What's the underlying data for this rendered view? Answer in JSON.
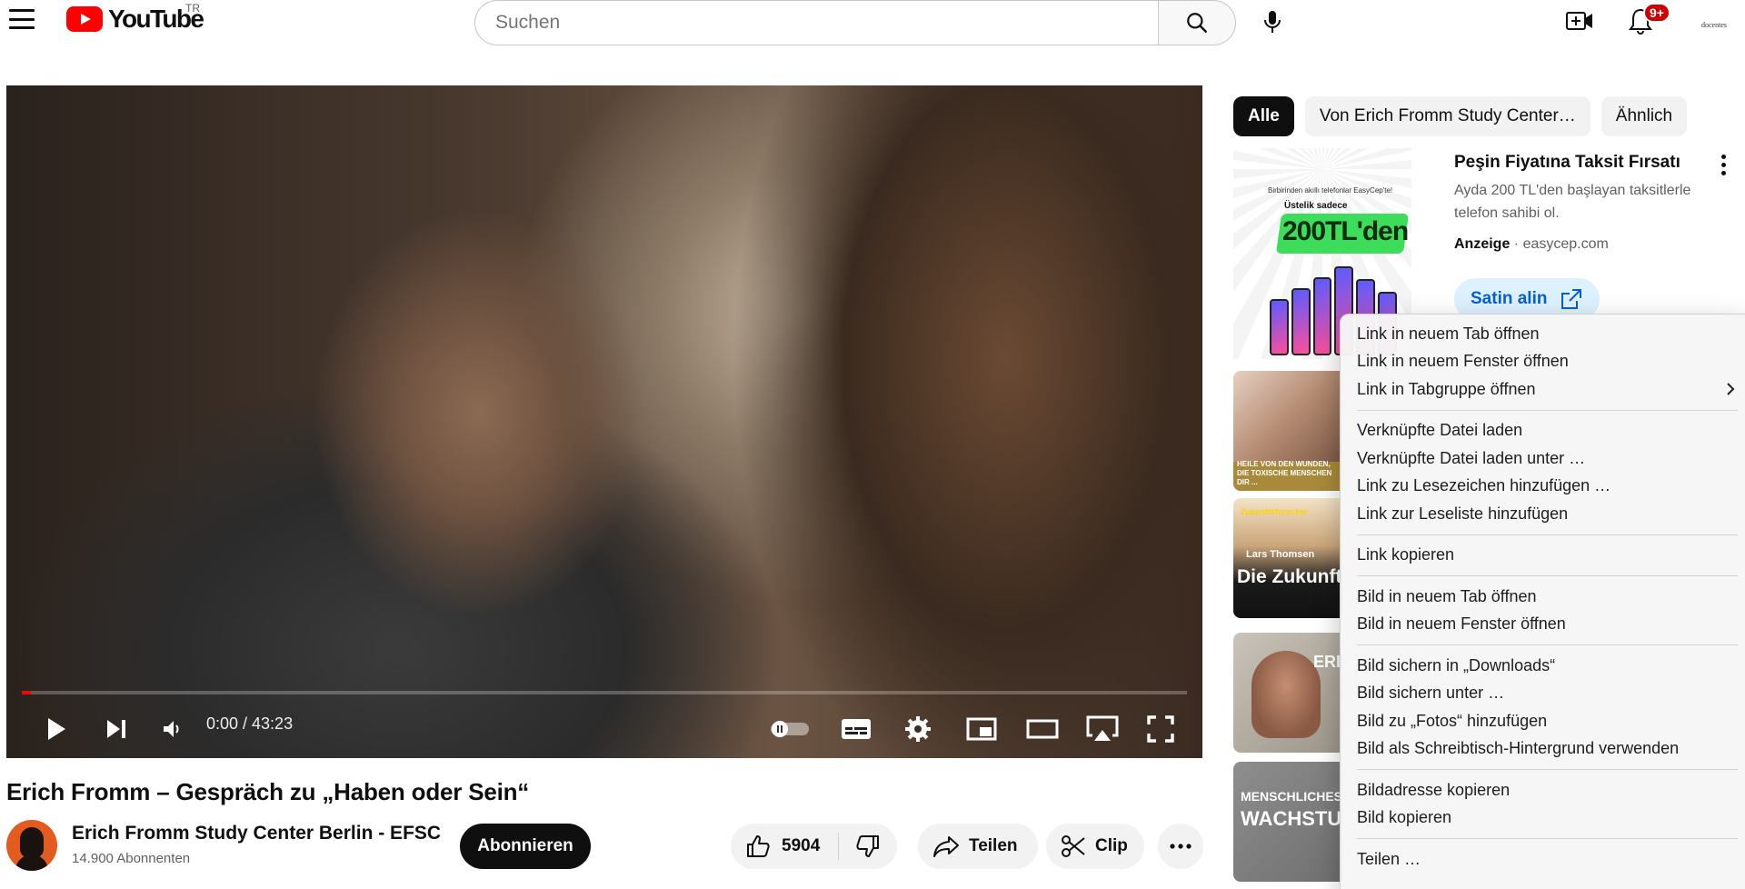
{
  "header": {
    "logo_text": "YouTube",
    "country_code": "TR",
    "search_placeholder": "Suchen",
    "notification_count": "9+",
    "account_label": "docentes"
  },
  "player": {
    "time_display": "0:00 / 43:23",
    "progress_fraction": 0.008
  },
  "video": {
    "title": "Erich Fromm – Gespräch zu „Haben oder Sein“",
    "channel_name": "Erich Fromm Study Center Berlin - EFSC",
    "subscribers": "14.900 Abonnenten",
    "subscribe_label": "Abonnieren",
    "like_count": "5904",
    "share_label": "Teilen",
    "clip_label": "Clip"
  },
  "filters": [
    "Alle",
    "Von Erich Fromm Study Center…",
    "Ähnlich"
  ],
  "ad": {
    "image_line1": "Birbirinden akıllı telefonlar EasyCep'te!",
    "image_line2": "Üstelik sadece",
    "image_price": "200TL'den",
    "title": "Peşin Fiyatına Taksit Fırsatı",
    "description": "Ayda 200 TL'den başlayan taksitlerle telefon sahibi ol.",
    "label": "Anzeige",
    "domain": "easycep.com",
    "cta": "Satin alin"
  },
  "recommendations": {
    "rec1_caption": "HEILE VON DEN WUNDEN, DIE TOXISCHE MENSCHEN DIR ...",
    "rec2_tag": "Zukunftsforscher",
    "rec2_name": "Lars Thomsen",
    "rec2_title": "Die Zukunft außer für...",
    "rec3_text": "ERI",
    "rec4_line1": "MENSCHLICHES",
    "rec4_line2": "WACHSTUM"
  },
  "context_menu": {
    "items": [
      "Link in neuem Tab öffnen",
      "Link in neuem Fenster öffnen",
      "Link in Tabgruppe öffnen",
      "Verknüpfte Datei laden",
      "Verknüpfte Datei laden unter …",
      "Link zu Lesezeichen hinzufügen …",
      "Link zur Leseliste hinzufügen",
      "Link kopieren",
      "Bild in neuem Tab öffnen",
      "Bild in neuem Fenster öffnen",
      "Bild sichern in „Downloads“",
      "Bild sichern unter …",
      "Bild zu „Fotos“ hinzufügen",
      "Bild als Schreibtisch-Hintergrund verwenden",
      "Bildadresse kopieren",
      "Bild kopieren",
      "Teilen …"
    ]
  },
  "colors": {
    "brand_red": "#ff0000",
    "ad_cta_bg": "#def1ff",
    "ad_cta_text": "#065fd4"
  }
}
